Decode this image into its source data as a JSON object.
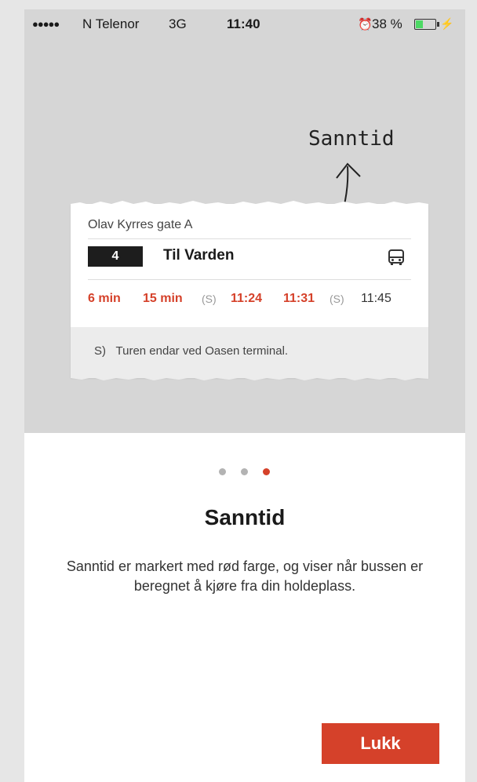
{
  "status_bar": {
    "signal": "●●●●●",
    "carrier": "N Telenor",
    "network": "3G",
    "time": "11:40",
    "alarm_icon": "alarm-icon",
    "battery": "38 %",
    "battery_level": 0.38,
    "battery_color": "#4cd964"
  },
  "annotation": {
    "label": "Sanntid"
  },
  "card": {
    "stop_name": "Olav Kyrres gate A",
    "route_number": "4",
    "destination": "Til Varden",
    "departures": {
      "d1": "6 min",
      "d2": "15 min",
      "s1": "(S)",
      "d3": "11:24",
      "d4": "11:31",
      "s2": "(S)",
      "d5": "11:45"
    },
    "note_marker": "S)",
    "note": "Turen endar ved Oasen terminal."
  },
  "pager": {
    "total": 3,
    "active": 3
  },
  "title": "Sanntid",
  "description": "Sanntid er markert med rød farge, og viser når bussen er beregnet å kjøre fra din holdeplass.",
  "close_label": "Lukk",
  "colors": {
    "accent": "#d5412a",
    "background": "#d6d6d6"
  }
}
